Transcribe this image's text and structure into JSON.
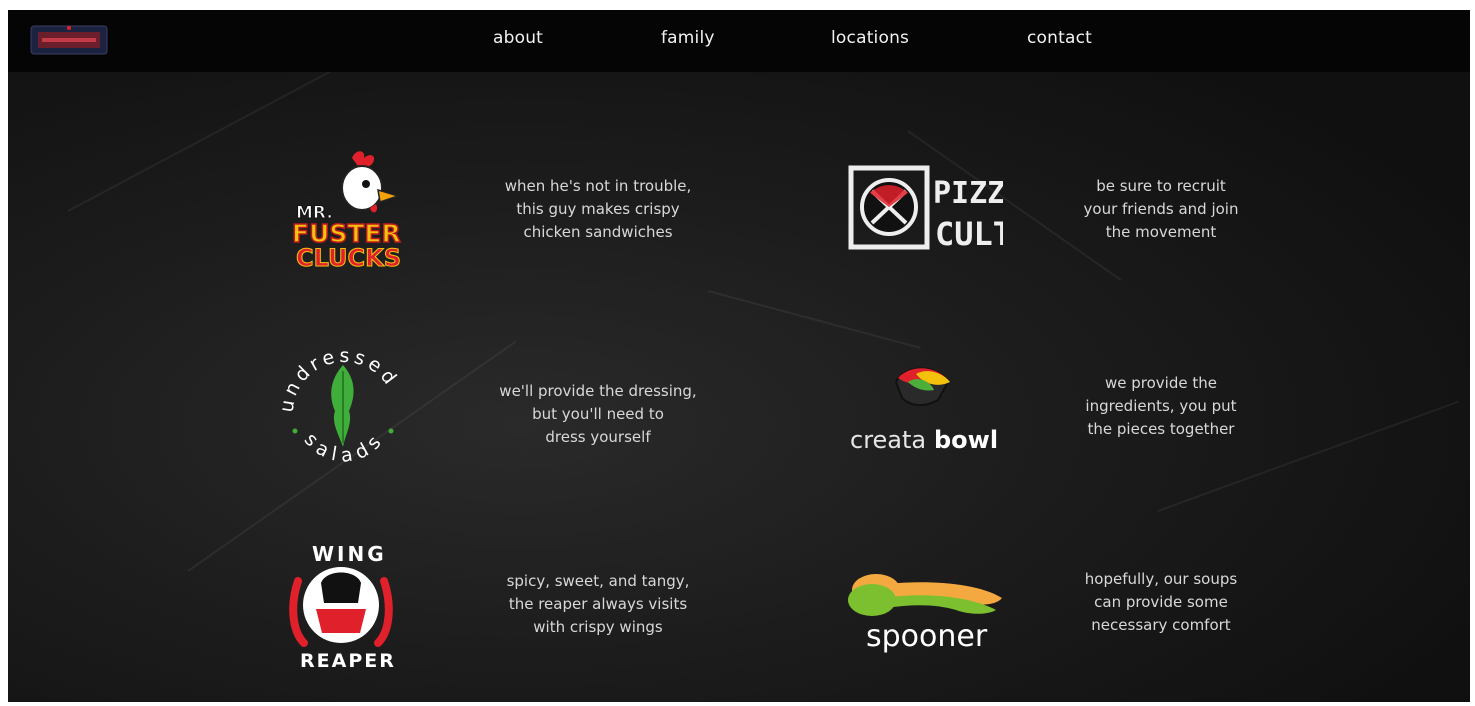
{
  "nav": {
    "logo_icon": "restaurant-group-logo",
    "links": [
      "about",
      "family",
      "locations",
      "contact"
    ]
  },
  "brands": [
    {
      "logo_text": [
        "MR.",
        "FUSTER",
        "CLUCKS"
      ],
      "lines": [
        "when he's not in trouble,",
        "this guy makes crispy",
        "chicken sandwiches"
      ]
    },
    {
      "logo_text": [
        "PIZZA",
        "CULT"
      ],
      "lines": [
        "be sure to recruit",
        "your friends and join",
        "the movement"
      ]
    },
    {
      "logo_text": [
        "undressed",
        "salads"
      ],
      "lines": [
        "we'll provide the dressing,",
        "but you'll need to",
        "dress yourself"
      ]
    },
    {
      "logo_text": [
        "creata",
        "bowl"
      ],
      "lines": [
        "we provide the",
        "ingredients, you put",
        "the pieces together"
      ]
    },
    {
      "logo_text": [
        "WING",
        "REAPER"
      ],
      "lines": [
        "spicy, sweet, and tangy,",
        "the reaper always visits",
        "with crispy wings"
      ]
    },
    {
      "logo_text": [
        "spooner"
      ],
      "lines": [
        "hopefully, our soups",
        "can provide some",
        "necessary comfort"
      ]
    }
  ],
  "colors": {
    "background": "#141414",
    "navbar": "#050505",
    "text": "#d8d8d8",
    "accent_red": "#e0202a",
    "accent_yellow": "#f4c20d",
    "accent_green": "#4caf3a"
  }
}
